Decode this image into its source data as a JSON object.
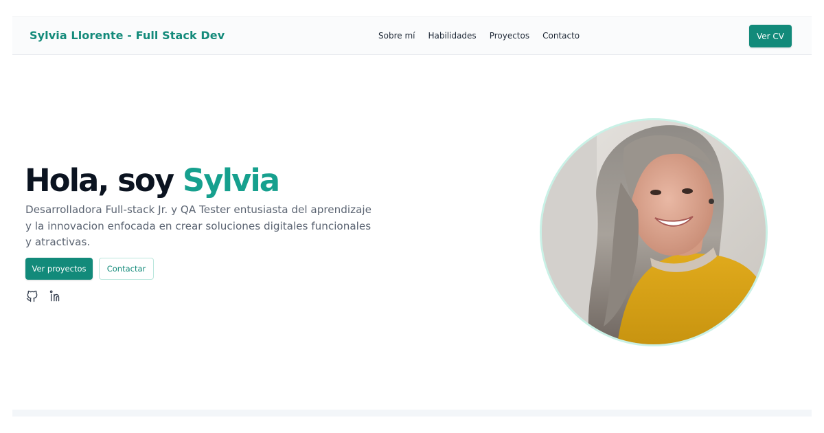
{
  "brand": {
    "name": "Sylvia Llorente - Full Stack Dev"
  },
  "nav": {
    "links": [
      "Sobre mí",
      "Habilidades",
      "Proyectos",
      "Contacto"
    ],
    "cv_button": "Ver CV"
  },
  "hero": {
    "greeting": "Hola, soy",
    "name": "Sylvia",
    "description": "Desarrolladora Full-stack Jr. y QA Tester entusiasta del aprendizaje y la innovacion enfocada en crear soluciones digitales funcionales y atractivas.",
    "primary_button": "Ver proyectos",
    "secondary_button": "Contactar"
  },
  "social_icons": [
    "github-icon",
    "linkedin-icon"
  ],
  "colors": {
    "accent": "#128a7a",
    "accent_light": "#16a08e",
    "title": "#0b1320",
    "text_muted": "#5b6472"
  }
}
